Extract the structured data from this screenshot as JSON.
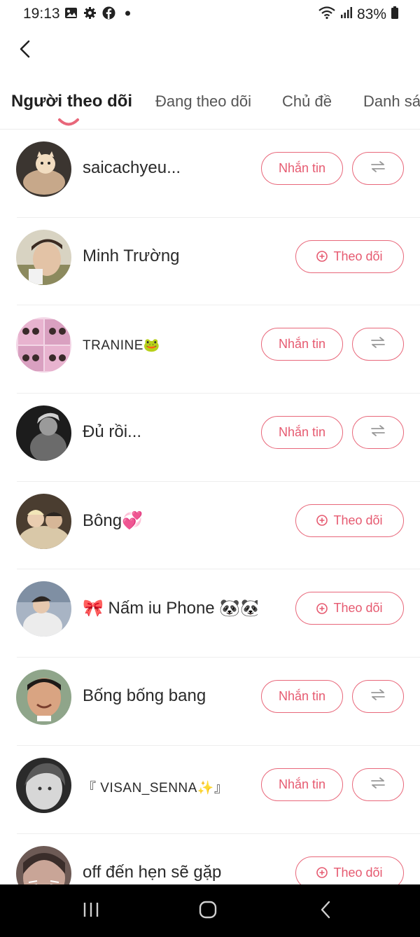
{
  "status_bar": {
    "time": "19:13",
    "battery": "83%",
    "left_icons": [
      "gallery-icon",
      "settings-gear-icon",
      "facebook-icon",
      "dot-icon"
    ],
    "right_icons": [
      "wifi-icon",
      "signal-icon",
      "battery-icon"
    ]
  },
  "header": {
    "back_icon": "chevron-left-icon"
  },
  "tabs": [
    {
      "label": "Người theo dõi",
      "active": true
    },
    {
      "label": "Đang theo dõi",
      "active": false
    },
    {
      "label": "Chủ đề",
      "active": false
    },
    {
      "label": "Danh sác",
      "active": false
    }
  ],
  "buttons": {
    "message_label": "Nhắn tin",
    "follow_label": "Theo dõi",
    "switch_icon": "swap-arrows-icon",
    "follow_icon": "plus-circle-icon"
  },
  "users": [
    {
      "name": "saicachyeu...",
      "relation": "mutual"
    },
    {
      "name": "Minh Trường",
      "relation": "follower"
    },
    {
      "name": "TRANINE🐸",
      "relation": "mutual"
    },
    {
      "name": "Đủ rồi...",
      "relation": "mutual"
    },
    {
      "name": "Bông💞",
      "relation": "follower"
    },
    {
      "name": "🎀 Nấm iu Phone 🐼🐼",
      "relation": "follower"
    },
    {
      "name": "Bống bống bang",
      "relation": "mutual"
    },
    {
      "name": "『 VISAN_SENNA✨』",
      "relation": "mutual"
    },
    {
      "name": "off đến hẹn sẽ gặp",
      "relation": "follower"
    }
  ],
  "nav_bar": {
    "icons": [
      "recent-apps-icon",
      "home-icon",
      "back-icon"
    ]
  },
  "colors": {
    "accent": "#e8677a",
    "text": "#2a2a2a",
    "nav_background": "#000000"
  }
}
